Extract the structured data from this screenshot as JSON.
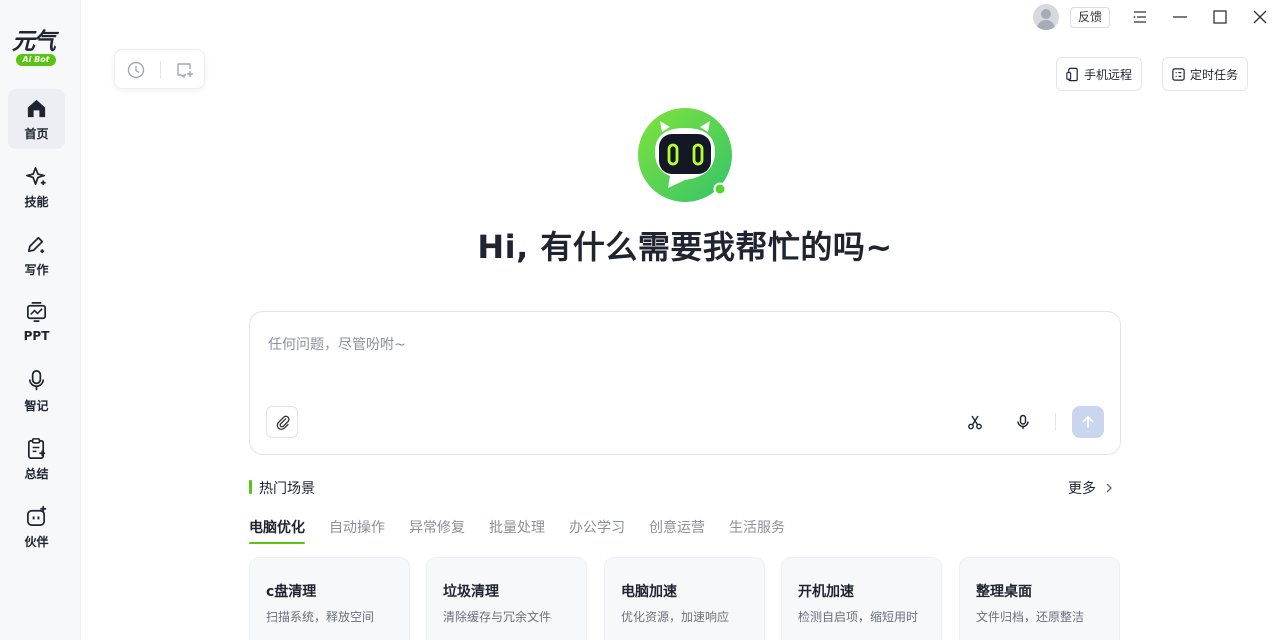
{
  "app": {
    "logo_text": "元气",
    "logo_badge": "Ai Bot",
    "accent_color": "#5ac414"
  },
  "sidebar": {
    "items": [
      {
        "label": "首页",
        "icon": "home-icon",
        "active": true
      },
      {
        "label": "技能",
        "icon": "sparkle-icon",
        "active": false
      },
      {
        "label": "写作",
        "icon": "pen-icon",
        "active": false
      },
      {
        "label": "PPT",
        "icon": "presentation-icon",
        "active": false
      },
      {
        "label": "智记",
        "icon": "microphone-icon",
        "active": false
      },
      {
        "label": "总结",
        "icon": "clipboard-icon",
        "active": false
      },
      {
        "label": "伙伴",
        "icon": "bot-face-icon",
        "active": false
      }
    ]
  },
  "titlebar": {
    "feedback_label": "反馈"
  },
  "top_actions": {
    "phone_remote": "手机远程",
    "scheduled_task": "定时任务"
  },
  "hero": {
    "title": "Hi, 有什么需要我帮忙的吗~"
  },
  "input": {
    "placeholder": "任何问题，尽管吩咐~"
  },
  "hot": {
    "title": "热门场景",
    "more": "更多",
    "tabs": [
      "电脑优化",
      "自动操作",
      "异常修复",
      "批量处理",
      "办公学习",
      "创意运营",
      "生活服务"
    ],
    "active_tab": "电脑优化",
    "cards": [
      {
        "title": "c盘清理",
        "desc": "扫描系统，释放空间"
      },
      {
        "title": "垃圾清理",
        "desc": "清除缓存与冗余文件"
      },
      {
        "title": "电脑加速",
        "desc": "优化资源，加速响应"
      },
      {
        "title": "开机加速",
        "desc": "检测自启项，缩短用时"
      },
      {
        "title": "整理桌面",
        "desc": "文件归档，还原整洁"
      }
    ]
  }
}
